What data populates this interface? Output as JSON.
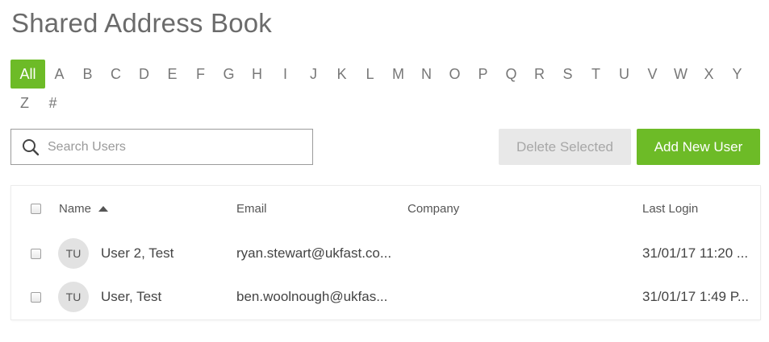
{
  "page": {
    "title": "Shared Address Book"
  },
  "alphabet": {
    "row1": [
      "All",
      "A",
      "B",
      "C",
      "D",
      "E",
      "F",
      "G",
      "H",
      "I",
      "J",
      "K",
      "L",
      "M",
      "N",
      "O",
      "P",
      "Q",
      "R",
      "S",
      "T",
      "U",
      "V",
      "W",
      "X",
      "Y"
    ],
    "row2": [
      "Z",
      "#"
    ],
    "active": "All",
    "accent": "#6dbb27"
  },
  "search": {
    "placeholder": "Search Users",
    "value": "",
    "icon": "search-icon"
  },
  "actions": {
    "delete_label": "Delete Selected",
    "add_label": "Add New User"
  },
  "table": {
    "headers": {
      "name": "Name",
      "email": "Email",
      "company": "Company",
      "last_login": "Last Login"
    },
    "sort": {
      "column": "name",
      "direction": "ascending"
    },
    "rows": [
      {
        "initials": "TU",
        "name": "User 2, Test",
        "email": "ryan.stewart@ukfast.co...",
        "company": "",
        "last_login": "31/01/17 11:20 ..."
      },
      {
        "initials": "TU",
        "name": "User, Test",
        "email": "ben.woolnough@ukfas...",
        "company": "",
        "last_login": "31/01/17 1:49 P..."
      }
    ]
  }
}
